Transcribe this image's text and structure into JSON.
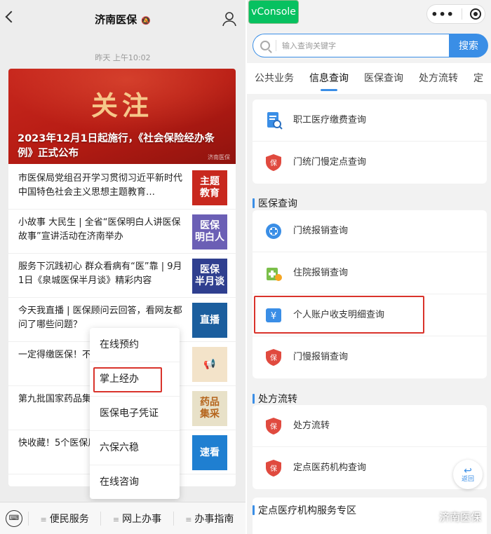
{
  "left": {
    "title": "济南医保",
    "time": "昨天 上午10:02",
    "banner": {
      "big": "关注",
      "caption": "2023年12月1日起施行，《社会保险经办条例》正式公布",
      "watermark": "济南医保"
    },
    "news": [
      {
        "text": "市医保局党组召开学习贯彻习近平新时代中国特色社会主义思想主题教育…",
        "thumb": "主题\n教育",
        "thumb_color": "#c8281e"
      },
      {
        "text": "小故事 大民生 | 全省“医保明白人讲医保故事”宣讲活动在济南举办",
        "thumb": "医保\n明白人",
        "thumb_color": "#6b5fb5"
      },
      {
        "text": "服务下沉践初心 群众看病有“医”靠 | 9月1日《泉城医保半月谈》精彩内容",
        "thumb": "医保\n半月谈",
        "thumb_color": "#2f3f8f"
      },
      {
        "text": "今天我直播 | 医保顾问云回答，看网友都问了哪些问题？",
        "thumb": "直播",
        "thumb_color": "#1b5e9e"
      },
      {
        "text": "一定得缴医保！不",
        "thumb": "📢",
        "thumb_color": "#f3e3c9"
      },
      {
        "text": "第九批国家药品集",
        "thumb": "药品\n集采",
        "thumb_color": "#e8e1c8"
      },
      {
        "text": "快收藏！5个医保用！",
        "thumb": "速看",
        "thumb_color": "#1f7fd1"
      }
    ],
    "popup": [
      "在线预约",
      "掌上经办",
      "医保电子凭证",
      "六保六稳",
      "在线咨询"
    ],
    "bottom_menu": [
      "便民服务",
      "网上办事",
      "办事指南"
    ]
  },
  "right": {
    "vconsole": "vConsole",
    "search": {
      "placeholder": "输入查询关键字",
      "button": "搜索"
    },
    "tabs": [
      "公共业务",
      "信息查询",
      "医保查询",
      "处方流转",
      "定"
    ],
    "active_tab": "信息查询",
    "panel1": [
      "职工医疗缴费查询",
      "门统门慢定点查询"
    ],
    "section2": {
      "title": "医保查询",
      "items": [
        "门统报销查询",
        "住院报销查询",
        "个人账户收支明细查询",
        "门慢报销查询"
      ]
    },
    "section3": {
      "title": "处方流转",
      "items": [
        "处方流转",
        "定点医药机构查询"
      ]
    },
    "section4": {
      "title": "定点医疗机构服务专区"
    },
    "back_fab": "返回",
    "watermark": "济南医保"
  },
  "colors": {
    "accent": "#3a8ee6",
    "highlight": "#d9332b",
    "banner": "#c8281e",
    "vconsole": "#07c160"
  }
}
